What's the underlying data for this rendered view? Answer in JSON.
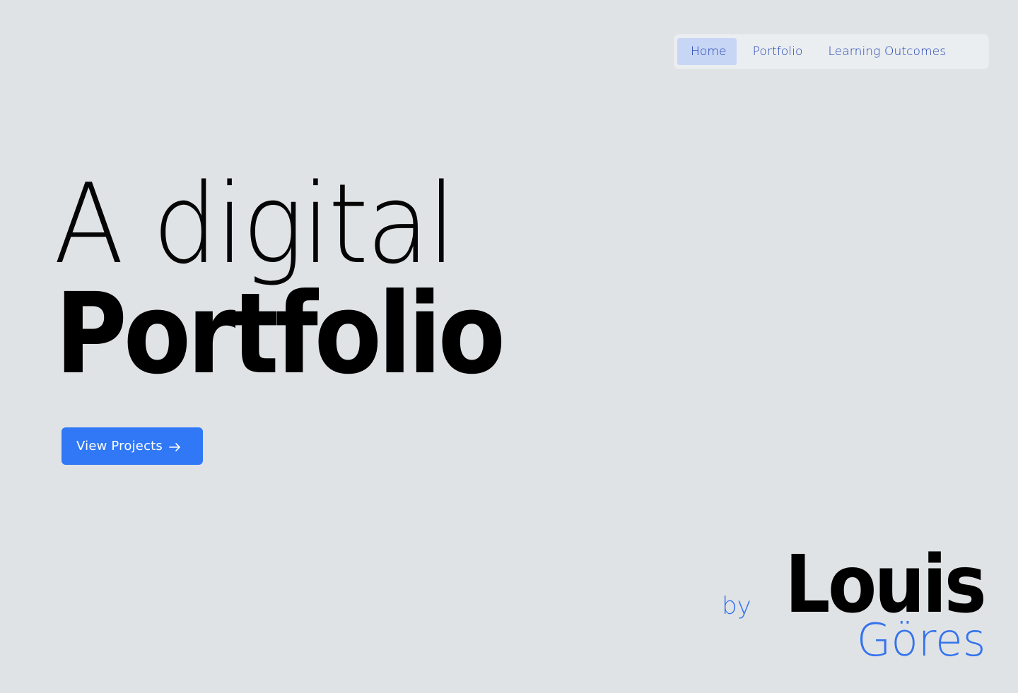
{
  "nav": {
    "items": [
      {
        "label": "Home",
        "active": true
      },
      {
        "label": "Portfolio",
        "active": false
      },
      {
        "label": "Learning Outcomes",
        "active": false
      }
    ]
  },
  "hero": {
    "line1": "A digital",
    "line2": "Portfolio"
  },
  "cta": {
    "label": "View Projects",
    "icon": "arrow-right-icon"
  },
  "author": {
    "by": "by",
    "first_name": "Louis",
    "last_name": "Göres"
  },
  "colors": {
    "background": "#e0e3e5",
    "accent": "#3078f5",
    "nav_text": "#1e3fae",
    "nav_active_bg": "#c8d6f6"
  }
}
